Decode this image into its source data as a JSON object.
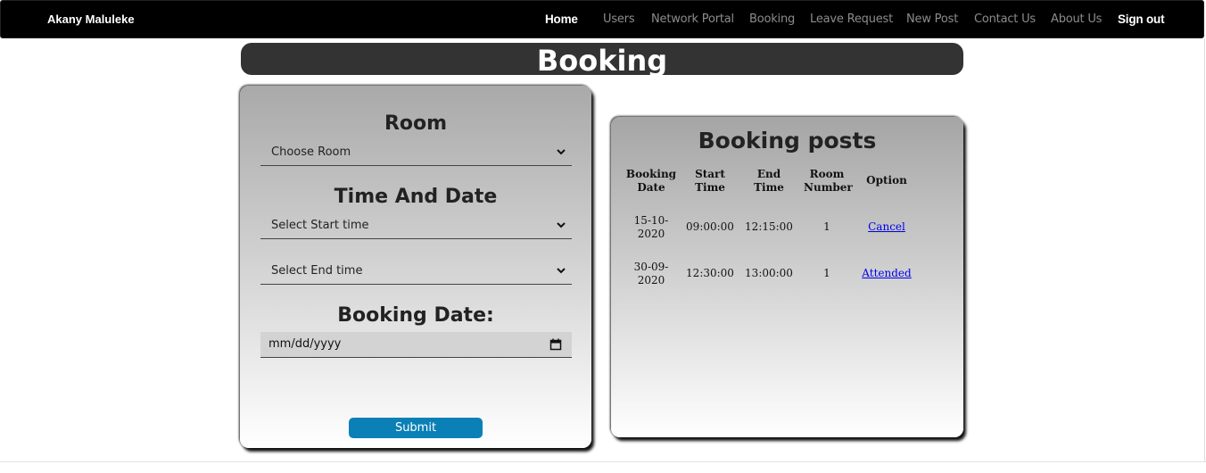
{
  "navbar": {
    "brand": "Akany Maluleke",
    "links": [
      {
        "label": "Home",
        "active": true
      },
      {
        "label": "Users",
        "active": false
      },
      {
        "label": "Network Portal",
        "active": false
      },
      {
        "label": "Booking",
        "active": false
      },
      {
        "label": "Leave Request",
        "active": false
      },
      {
        "label": "New Post",
        "active": false
      },
      {
        "label": "Contact Us",
        "active": false
      },
      {
        "label": "About Us",
        "active": false
      },
      {
        "label": "Sign out",
        "active": true
      }
    ]
  },
  "page": {
    "title": "Booking"
  },
  "form": {
    "room_heading": "Room",
    "room_select": "Choose Room",
    "time_heading": "Time And Date",
    "start_select": "Select Start time",
    "end_select": "Select End time",
    "date_heading": "Booking Date:",
    "date_placeholder": "mm/dd/yyyy",
    "submit_label": "Submit"
  },
  "posts": {
    "title": "Booking posts",
    "headers": [
      "Booking Date",
      "Start Time",
      "End Time",
      "Room Number",
      "Option"
    ],
    "rows": [
      {
        "date": "15-10-2020",
        "start": "09:00:00",
        "end": "12:15:00",
        "room": "1",
        "option": "Cancel"
      },
      {
        "date": "30-09-2020",
        "start": "12:30:00",
        "end": "13:00:00",
        "room": "1",
        "option": "Attended"
      }
    ]
  },
  "colors": {
    "navbar_bg": "#000000",
    "title_bar_bg": "#333333",
    "submit_bg": "#0b80b6",
    "link": "#0000ee"
  }
}
